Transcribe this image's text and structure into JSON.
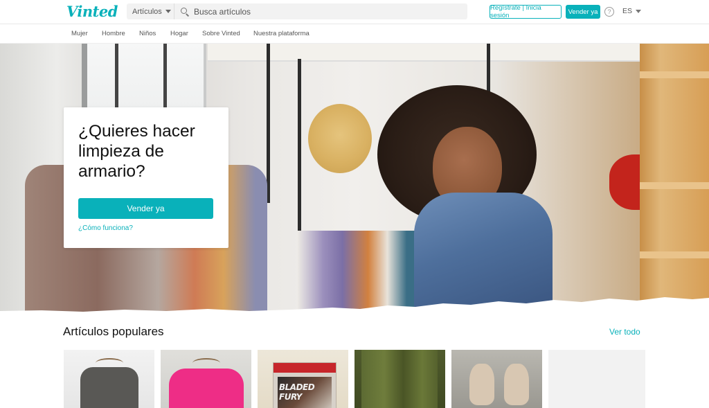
{
  "header": {
    "logo": "Vinted",
    "category_select": "Artículos",
    "search_placeholder": "Busca artículos",
    "login_label": "Regístrate | Inicia sesión",
    "sell_label": "Vender ya",
    "help_symbol": "?",
    "language": "ES"
  },
  "catnav": {
    "items": [
      "Mujer",
      "Hombre",
      "Niños",
      "Hogar",
      "Sobre Vinted",
      "Nuestra plataforma"
    ]
  },
  "hero": {
    "title": "¿Quieres hacer limpieza de armario?",
    "cta": "Vender ya",
    "link": "¿Cómo funciona?"
  },
  "popular": {
    "title": "Artículos populares",
    "see_all": "Ver todo",
    "product_texts": [
      "BLADED FURY"
    ]
  },
  "colors": {
    "brand": "#09b1ba",
    "text": "#111111",
    "muted": "#555555"
  },
  "icons": [
    "search-icon",
    "chevron-down-icon",
    "help-icon"
  ]
}
